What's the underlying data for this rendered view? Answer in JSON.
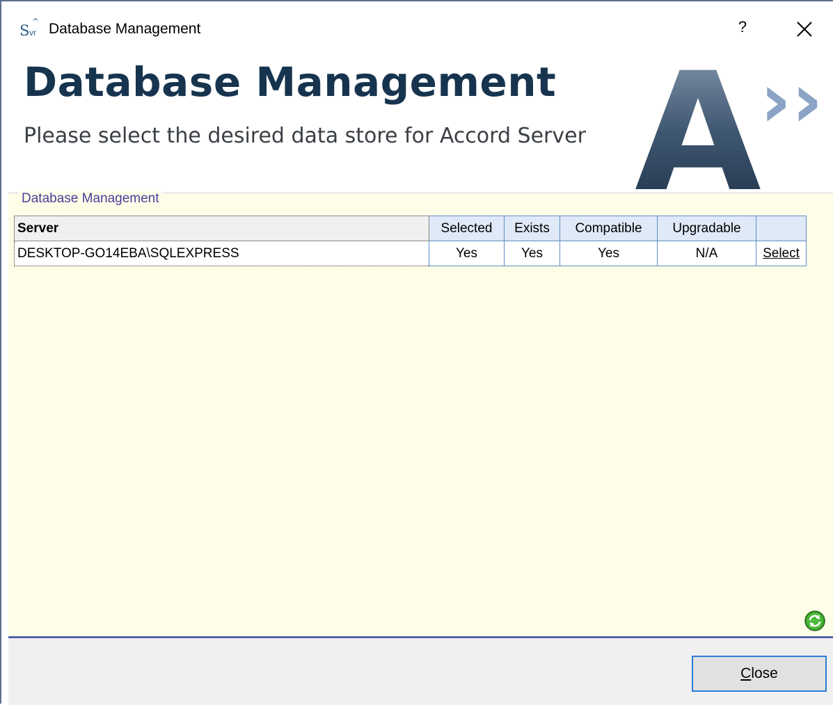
{
  "window": {
    "title": "Database Management",
    "help_label": "?",
    "app_icon": {
      "s": "S",
      "vr": "vr",
      "caret": "^"
    }
  },
  "header": {
    "heading": "Database Management",
    "subheading": "Please select the desired data store for Accord Server",
    "logo_letter": "A",
    "logo_chevrons": "››"
  },
  "group": {
    "label": "Database Management"
  },
  "grid": {
    "columns": [
      "Server",
      "Selected",
      "Exists",
      "Compatible",
      "Upgradable",
      ""
    ],
    "rows": [
      {
        "server": "DESKTOP-GO14EBA\\SQLEXPRESS",
        "selected": "Yes",
        "exists": "Yes",
        "compatible": "Yes",
        "upgradable": "N/A",
        "action": "Select"
      }
    ]
  },
  "footer": {
    "close_label_accel": "C",
    "close_label_rest": "lose"
  },
  "colors": {
    "heading": "#17344f",
    "group_background": "#fdfde8",
    "grid_border": "#5c8ec8",
    "button_focus": "#2a7cd6",
    "separator": "#5563a3"
  },
  "icons": {
    "close": "close-icon",
    "refresh": "refresh-icon",
    "app": "app-icon"
  }
}
